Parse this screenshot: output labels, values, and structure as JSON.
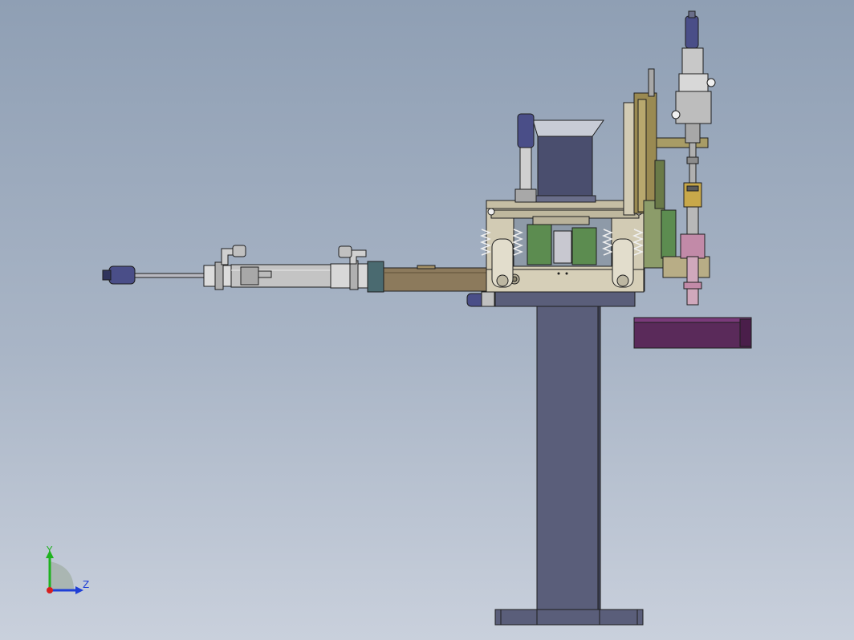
{
  "view": {
    "background_top": "#8f9fb4",
    "background_bottom": "#c9d0dc"
  },
  "triad": {
    "y_label": "Y",
    "z_label": "Z",
    "y_color": "#1fb21f",
    "z_color": "#1f3fd6",
    "x_color": "#d61f1f"
  },
  "colors": {
    "base_column": "#5a5e7a",
    "arm": "#8c7a5c",
    "cylinder": "#c8c8c8",
    "housing": "#d2cbb4",
    "motor": "#4a4e6e",
    "fitting": "#4a4e88",
    "green_part": "#5c8c50",
    "purple_block": "#5a2a5a",
    "copper": "#9a8a52",
    "pink": "#c28aa8",
    "outline": "#1e1e1e"
  }
}
